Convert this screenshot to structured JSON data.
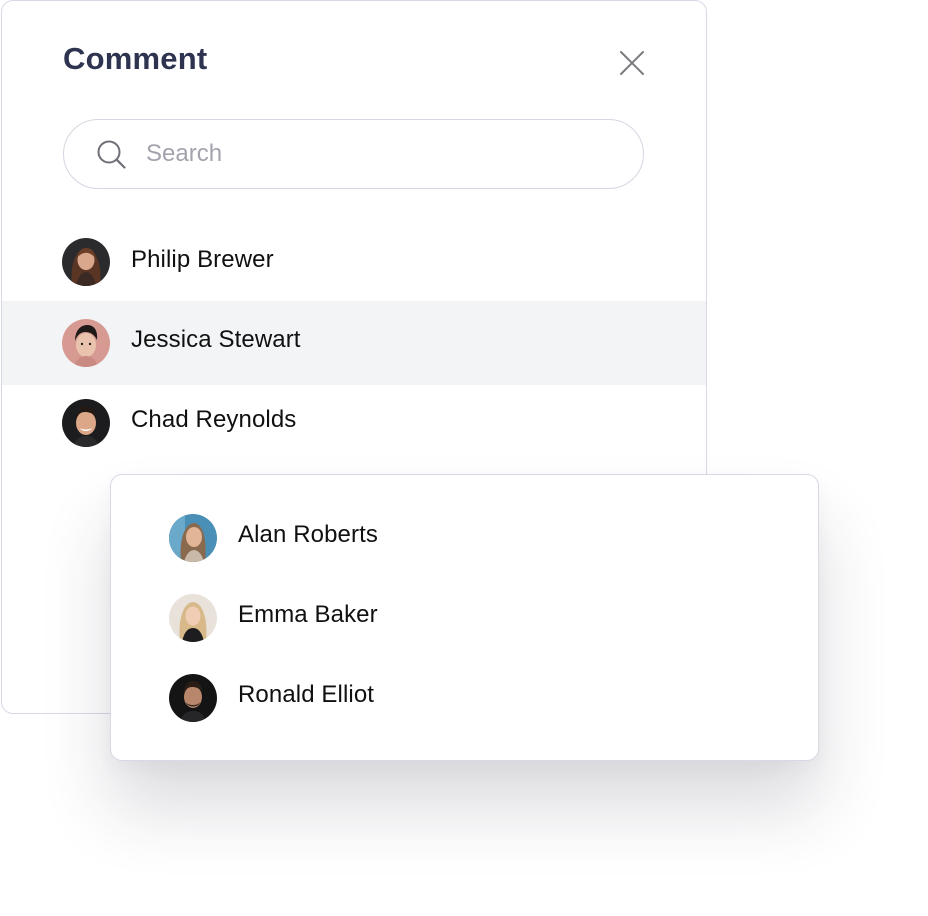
{
  "panel": {
    "title": "Comment",
    "close_icon": "close-icon",
    "search": {
      "placeholder": "Search",
      "value": "",
      "icon": "search-icon"
    },
    "people": [
      {
        "name": "Philip Brewer",
        "highlighted": false
      },
      {
        "name": "Jessica Stewart",
        "highlighted": true
      },
      {
        "name": "Chad Reynolds",
        "highlighted": false
      }
    ]
  },
  "popup": {
    "people": [
      {
        "name": "Alan Roberts"
      },
      {
        "name": "Emma Baker"
      },
      {
        "name": "Ronald Elliot"
      }
    ]
  },
  "colors": {
    "title": "#2e3450",
    "border": "#d9d8e6",
    "highlight_row": "#f3f4f6",
    "placeholder": "#a3a3ad",
    "name_text": "#101010"
  }
}
